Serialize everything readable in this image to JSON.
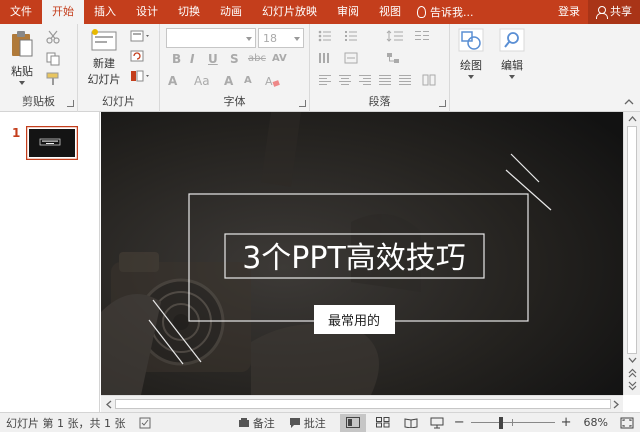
{
  "ribbon_tabs": [
    "文件",
    "开始",
    "插入",
    "设计",
    "切换",
    "动画",
    "幻灯片放映",
    "审阅",
    "视图"
  ],
  "active_tab": "开始",
  "tell_me": "告诉我...",
  "login": "登录",
  "share": "共享",
  "groups": {
    "clipboard": {
      "label": "剪贴板",
      "paste": "粘贴"
    },
    "slides": {
      "label": "幻灯片",
      "new_slide_line1": "新建",
      "new_slide_line2": "幻灯片"
    },
    "font": {
      "label": "字体",
      "size": "18"
    },
    "paragraph": {
      "label": "段落"
    },
    "drawing": {
      "label": "绘图"
    },
    "editing": {
      "label": "编辑"
    }
  },
  "thumbnail": {
    "number": "1"
  },
  "slide": {
    "title": "3个PPT高效技巧",
    "subtitle": "最常用的"
  },
  "status": {
    "slide_info": "幻灯片 第 1 张，共 1 张",
    "notes": "备注",
    "comments": "批注",
    "zoom": "68%"
  },
  "colors": {
    "accent": "#c43e1c",
    "ribbon_bg": "#f3f3f3",
    "slide_bg": "#1a1a1a"
  }
}
